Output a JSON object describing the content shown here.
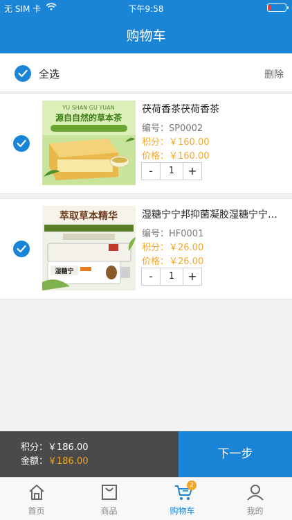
{
  "status_bar": {
    "carrier": "无 SIM 卡",
    "time": "下午9:58",
    "battery_level": 0.12,
    "battery_color": "#ff3b30"
  },
  "header": {
    "title": "购物车"
  },
  "select_bar": {
    "select_all_label": "全选",
    "delete_label": "删除",
    "select_all_checked": true
  },
  "items": [
    {
      "checked": true,
      "image_icon": "herbal-tea-box-icon",
      "name": "茯荷香茶茯荷香茶",
      "code_label": "编号：",
      "code": "SP0002",
      "points_label": "积分：",
      "points": "￥160.00",
      "price_label": "价格：",
      "price": "￥160.00",
      "minus": "-",
      "qty": "1",
      "plus": "+"
    },
    {
      "checked": true,
      "image_icon": "ointment-tube-icon",
      "name": "湿糖宁宁邦抑菌凝胶湿糖宁宁邦抑菌凝胶",
      "code_label": "编号：",
      "code": "HF0001",
      "points_label": "积分：",
      "points": "￥26.00",
      "price_label": "价格：",
      "price": "￥26.00",
      "minus": "-",
      "qty": "1",
      "plus": "+"
    }
  ],
  "summary": {
    "points_label": "积分：",
    "points_value": "￥186.00",
    "amount_label": "金额：",
    "amount_value": "￥186.00"
  },
  "next_button": "下一步",
  "tabbar": {
    "tabs": [
      {
        "label": "首页",
        "icon": "home-icon",
        "active": false
      },
      {
        "label": "商品",
        "icon": "shopping-bag-icon",
        "active": false
      },
      {
        "label": "购物车",
        "icon": "cart-icon",
        "active": true,
        "badge": "2"
      },
      {
        "label": "我的",
        "icon": "profile-icon",
        "active": false
      }
    ]
  },
  "colors": {
    "primary": "#1a84d6",
    "accent": "#f5a623",
    "summary_bg": "#4a4a4a"
  }
}
